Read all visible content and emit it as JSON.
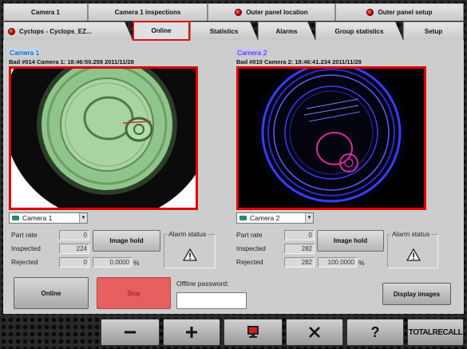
{
  "top_tabs": [
    {
      "label": "Camera 1",
      "indicator": false
    },
    {
      "label": "Camera 1 inspections",
      "indicator": false
    },
    {
      "label": "Outer panel location",
      "indicator": true
    },
    {
      "label": "Outer panel setup",
      "indicator": true
    }
  ],
  "second_tabs": {
    "project": "Cyclops - Cyclops_EZ...",
    "items": [
      "Online",
      "Statistics",
      "Alarms",
      "Group statistics",
      "Setup"
    ],
    "active": "Online"
  },
  "camera1": {
    "title": "Camera 1",
    "info": "Bad #014  Camera 1: 18:46:50.258 2011/11/28",
    "selector": "Camera 1",
    "part_rate_label": "Part rate",
    "part_rate": "0",
    "inspected_label": "Inspected",
    "inspected": "224",
    "rejected_label": "Rejected",
    "rejected": "0",
    "reject_percent": "0.0000",
    "percent_sign": "%",
    "image_hold_label": "Image hold",
    "alarm_status_label": "Alarm status",
    "image_tint": "#8fc58a"
  },
  "camera2": {
    "title": "Camera 2",
    "info": "Bad #010  Camera 2: 18:46:41.234 2011/11/28",
    "selector": "Camera 2",
    "part_rate_label": "Part rate",
    "part_rate": "0",
    "inspected_label": "Inspected",
    "inspected": "282",
    "rejected_label": "Rejected",
    "rejected": "282",
    "reject_percent": "100.0000",
    "percent_sign": "%",
    "image_hold_label": "Image hold",
    "alarm_status_label": "Alarm status",
    "image_tint": "#3a3cff"
  },
  "controls": {
    "online_label": "Online",
    "stop_label": "Stop",
    "offline_password_label": "Offline password:",
    "offline_password_value": "",
    "display_images_label": "Display images"
  },
  "toolbar": {
    "minus_icon": "minus-icon",
    "plus_icon": "plus-icon",
    "monitor_icon": "monitor-icon",
    "close_icon": "close-icon",
    "help_icon": "help-icon",
    "brand": "TOTALRECALL"
  },
  "colors": {
    "active_border": "#d11111",
    "image_frame": "#e00000",
    "stop_button": "#e85f5f"
  }
}
